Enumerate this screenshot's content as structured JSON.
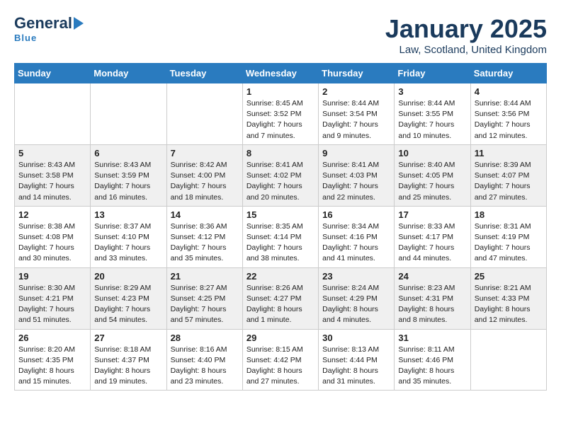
{
  "logo": {
    "general": "General",
    "blue": "Blue",
    "subtitle": "Blue"
  },
  "title": "January 2025",
  "location": "Law, Scotland, United Kingdom",
  "weekdays": [
    "Sunday",
    "Monday",
    "Tuesday",
    "Wednesday",
    "Thursday",
    "Friday",
    "Saturday"
  ],
  "weeks": [
    [
      {
        "day": "",
        "info": ""
      },
      {
        "day": "",
        "info": ""
      },
      {
        "day": "",
        "info": ""
      },
      {
        "day": "1",
        "info": "Sunrise: 8:45 AM\nSunset: 3:52 PM\nDaylight: 7 hours\nand 7 minutes."
      },
      {
        "day": "2",
        "info": "Sunrise: 8:44 AM\nSunset: 3:54 PM\nDaylight: 7 hours\nand 9 minutes."
      },
      {
        "day": "3",
        "info": "Sunrise: 8:44 AM\nSunset: 3:55 PM\nDaylight: 7 hours\nand 10 minutes."
      },
      {
        "day": "4",
        "info": "Sunrise: 8:44 AM\nSunset: 3:56 PM\nDaylight: 7 hours\nand 12 minutes."
      }
    ],
    [
      {
        "day": "5",
        "info": "Sunrise: 8:43 AM\nSunset: 3:58 PM\nDaylight: 7 hours\nand 14 minutes."
      },
      {
        "day": "6",
        "info": "Sunrise: 8:43 AM\nSunset: 3:59 PM\nDaylight: 7 hours\nand 16 minutes."
      },
      {
        "day": "7",
        "info": "Sunrise: 8:42 AM\nSunset: 4:00 PM\nDaylight: 7 hours\nand 18 minutes."
      },
      {
        "day": "8",
        "info": "Sunrise: 8:41 AM\nSunset: 4:02 PM\nDaylight: 7 hours\nand 20 minutes."
      },
      {
        "day": "9",
        "info": "Sunrise: 8:41 AM\nSunset: 4:03 PM\nDaylight: 7 hours\nand 22 minutes."
      },
      {
        "day": "10",
        "info": "Sunrise: 8:40 AM\nSunset: 4:05 PM\nDaylight: 7 hours\nand 25 minutes."
      },
      {
        "day": "11",
        "info": "Sunrise: 8:39 AM\nSunset: 4:07 PM\nDaylight: 7 hours\nand 27 minutes."
      }
    ],
    [
      {
        "day": "12",
        "info": "Sunrise: 8:38 AM\nSunset: 4:08 PM\nDaylight: 7 hours\nand 30 minutes."
      },
      {
        "day": "13",
        "info": "Sunrise: 8:37 AM\nSunset: 4:10 PM\nDaylight: 7 hours\nand 33 minutes."
      },
      {
        "day": "14",
        "info": "Sunrise: 8:36 AM\nSunset: 4:12 PM\nDaylight: 7 hours\nand 35 minutes."
      },
      {
        "day": "15",
        "info": "Sunrise: 8:35 AM\nSunset: 4:14 PM\nDaylight: 7 hours\nand 38 minutes."
      },
      {
        "day": "16",
        "info": "Sunrise: 8:34 AM\nSunset: 4:16 PM\nDaylight: 7 hours\nand 41 minutes."
      },
      {
        "day": "17",
        "info": "Sunrise: 8:33 AM\nSunset: 4:17 PM\nDaylight: 7 hours\nand 44 minutes."
      },
      {
        "day": "18",
        "info": "Sunrise: 8:31 AM\nSunset: 4:19 PM\nDaylight: 7 hours\nand 47 minutes."
      }
    ],
    [
      {
        "day": "19",
        "info": "Sunrise: 8:30 AM\nSunset: 4:21 PM\nDaylight: 7 hours\nand 51 minutes."
      },
      {
        "day": "20",
        "info": "Sunrise: 8:29 AM\nSunset: 4:23 PM\nDaylight: 7 hours\nand 54 minutes."
      },
      {
        "day": "21",
        "info": "Sunrise: 8:27 AM\nSunset: 4:25 PM\nDaylight: 7 hours\nand 57 minutes."
      },
      {
        "day": "22",
        "info": "Sunrise: 8:26 AM\nSunset: 4:27 PM\nDaylight: 8 hours\nand 1 minute."
      },
      {
        "day": "23",
        "info": "Sunrise: 8:24 AM\nSunset: 4:29 PM\nDaylight: 8 hours\nand 4 minutes."
      },
      {
        "day": "24",
        "info": "Sunrise: 8:23 AM\nSunset: 4:31 PM\nDaylight: 8 hours\nand 8 minutes."
      },
      {
        "day": "25",
        "info": "Sunrise: 8:21 AM\nSunset: 4:33 PM\nDaylight: 8 hours\nand 12 minutes."
      }
    ],
    [
      {
        "day": "26",
        "info": "Sunrise: 8:20 AM\nSunset: 4:35 PM\nDaylight: 8 hours\nand 15 minutes."
      },
      {
        "day": "27",
        "info": "Sunrise: 8:18 AM\nSunset: 4:37 PM\nDaylight: 8 hours\nand 19 minutes."
      },
      {
        "day": "28",
        "info": "Sunrise: 8:16 AM\nSunset: 4:40 PM\nDaylight: 8 hours\nand 23 minutes."
      },
      {
        "day": "29",
        "info": "Sunrise: 8:15 AM\nSunset: 4:42 PM\nDaylight: 8 hours\nand 27 minutes."
      },
      {
        "day": "30",
        "info": "Sunrise: 8:13 AM\nSunset: 4:44 PM\nDaylight: 8 hours\nand 31 minutes."
      },
      {
        "day": "31",
        "info": "Sunrise: 8:11 AM\nSunset: 4:46 PM\nDaylight: 8 hours\nand 35 minutes."
      },
      {
        "day": "",
        "info": ""
      }
    ]
  ]
}
